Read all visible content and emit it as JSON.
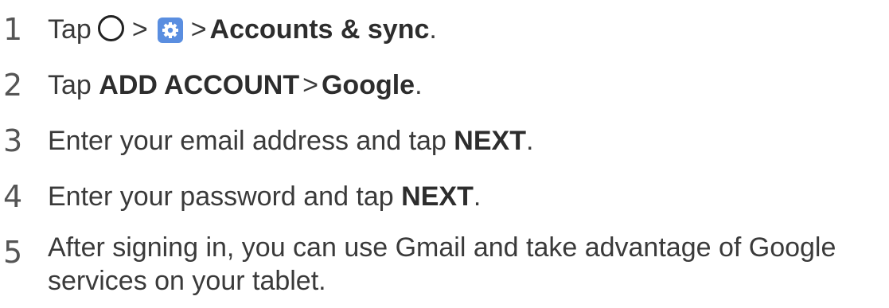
{
  "steps": [
    {
      "number": "1",
      "tap": "Tap",
      "gt1": ">",
      "gt2": ">",
      "target": "Accounts & sync",
      "end": ".",
      "home_icon": "home-button-icon",
      "settings_icon": "settings-gear-icon"
    },
    {
      "number": "2",
      "tap": "Tap",
      "action1": "ADD ACCOUNT",
      "gt": ">",
      "action2": "Google",
      "end": "."
    },
    {
      "number": "3",
      "text": "Enter your email address and tap",
      "action": "NEXT",
      "end": "."
    },
    {
      "number": "4",
      "text": "Enter your password and tap",
      "action": "NEXT",
      "end": "."
    },
    {
      "number": "5",
      "text": "After signing in, you can use Gmail and take advantage of Google services on your tablet."
    }
  ],
  "colors": {
    "settings_icon_bg": "#5a8ee0",
    "text": "#3a3a3a"
  }
}
